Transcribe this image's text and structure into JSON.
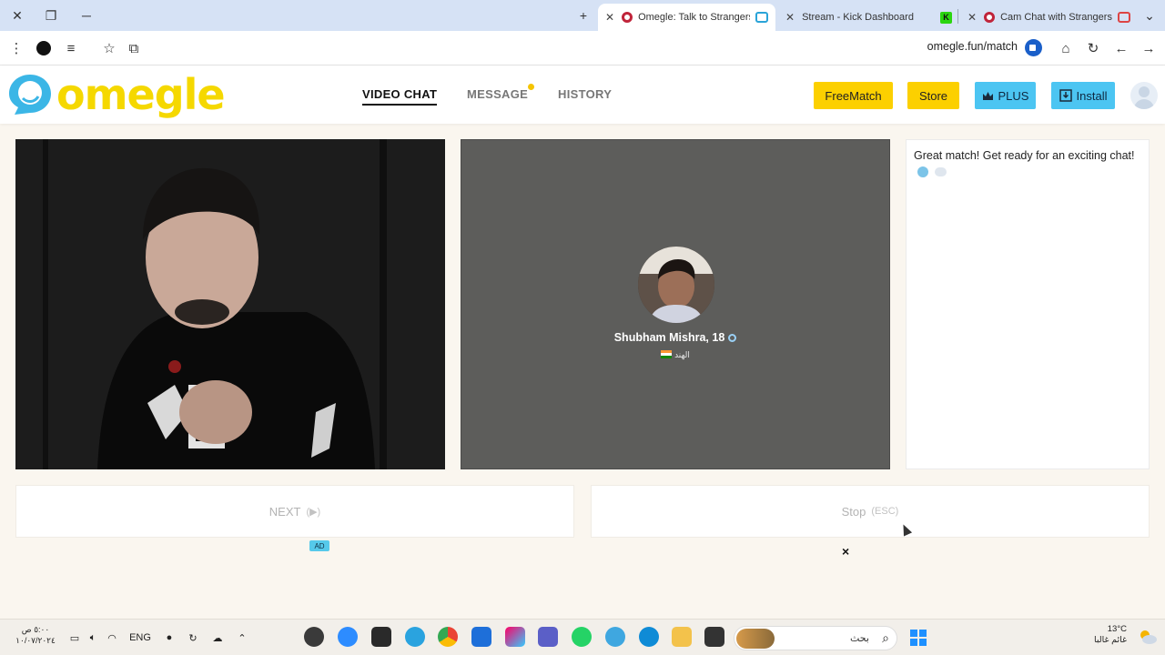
{
  "browser": {
    "tabs": [
      {
        "title": "Omegle: Talk to Strangers w",
        "active": true
      },
      {
        "title": "Stream - Kick Dashboard",
        "active": false
      },
      {
        "title": "Cam Chat with Strangers on",
        "active": false
      }
    ],
    "url": "omegle.fun/match"
  },
  "site": {
    "logo_text": "omegle",
    "nav": {
      "video_chat": "VIDEO CHAT",
      "message": "MESSAGE",
      "history": "HISTORY"
    },
    "buttons": {
      "freematch": "FreeMatch",
      "store": "Store",
      "plus": "PLUS",
      "install": "Install"
    }
  },
  "remote": {
    "name": "Shubham Mishra, 18",
    "country": "الهند"
  },
  "chat": {
    "message": "Great match! Get ready for an exciting chat!"
  },
  "controls": {
    "next_label": "NEXT",
    "next_hint": "(▶)",
    "stop_label": "Stop",
    "stop_hint": "(ESC)",
    "ad_label": "AD",
    "close_label": "×"
  },
  "taskbar": {
    "time": "٥:٠٠ ص",
    "date": "١٠/٠٧/٢٠٢٤",
    "lang": "ENG",
    "search_placeholder": "بحث",
    "temperature": "13°C",
    "weather_text": "غائم غالبا"
  },
  "colors": {
    "brand_yellow": "#fcd000",
    "brand_blue": "#4cc5f2",
    "remote_bg": "#5d5d5b",
    "page_bg": "#faf6ef"
  }
}
